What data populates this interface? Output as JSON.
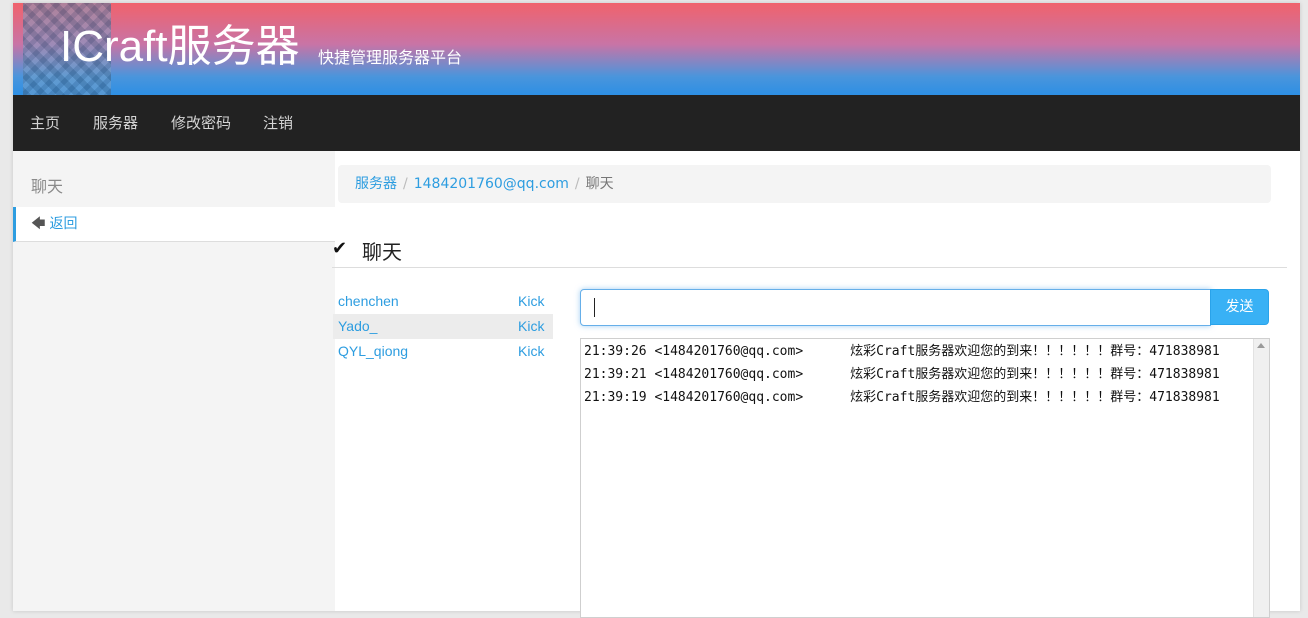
{
  "header": {
    "brand": "ICraft服务器",
    "tagline": "快捷管理服务器平台"
  },
  "nav": {
    "items": [
      {
        "label": "主页"
      },
      {
        "label": "服务器"
      },
      {
        "label": "修改密码"
      },
      {
        "label": "注销"
      }
    ]
  },
  "sidebar": {
    "title": "聊天",
    "back_icon": "arrow-left-icon",
    "back_label": "返回"
  },
  "breadcrumb": {
    "items": [
      "服务器",
      "1484201760@qq.com",
      "聊天"
    ],
    "separator": "/"
  },
  "section": {
    "icon": "checkmark-icon",
    "title": "聊天"
  },
  "players": [
    {
      "name": "chenchen",
      "action": "Kick"
    },
    {
      "name": "Yado_",
      "action": "Kick"
    },
    {
      "name": "QYL_qiong",
      "action": "Kick"
    }
  ],
  "chat": {
    "input_value": "",
    "send_label": "发送",
    "messages": [
      {
        "time": "21:39:26",
        "sender": "<1484201760@qq.com>",
        "text": "炫彩Craft服务器欢迎您的到来！！！！！！群号：471838981"
      },
      {
        "time": "21:39:21",
        "sender": "<1484201760@qq.com>",
        "text": "炫彩Craft服务器欢迎您的到来！！！！！！群号：471838981"
      },
      {
        "time": "21:39:19",
        "sender": "<1484201760@qq.com>",
        "text": "炫彩Craft服务器欢迎您的到来！！！！！！群号：471838981"
      }
    ]
  },
  "colors": {
    "accent": "#2d9de0",
    "navbar": "#222222",
    "send_button": "#39b1f5"
  }
}
